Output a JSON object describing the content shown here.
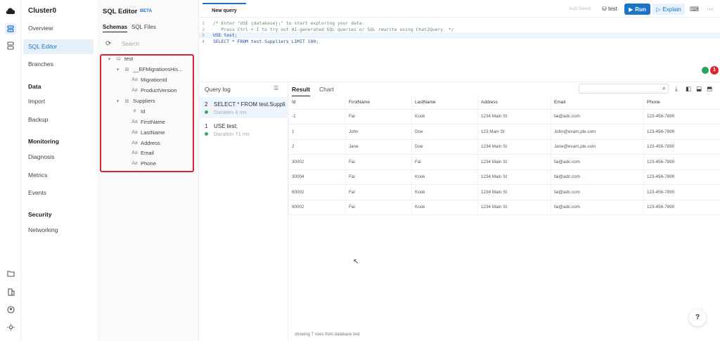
{
  "app": {
    "cluster_name": "Cluster0"
  },
  "nav": {
    "items": [
      {
        "label": "Overview"
      },
      {
        "label": "SQL Editor"
      },
      {
        "label": "Branches"
      }
    ],
    "data_section": "Data",
    "data_items": [
      {
        "label": "Import"
      },
      {
        "label": "Backup"
      }
    ],
    "monitoring_section": "Monitoring",
    "monitoring_items": [
      {
        "label": "Diagnosis"
      },
      {
        "label": "Metrics"
      },
      {
        "label": "Events"
      }
    ],
    "security_section": "Security",
    "security_items": [
      {
        "label": "Networking"
      }
    ]
  },
  "schema_panel": {
    "title": "SQL Editor",
    "badge": "BETA",
    "tabs": [
      "Schemas",
      "SQL Files"
    ],
    "search_placeholder": "Search",
    "tree": {
      "database": "test",
      "tables": [
        {
          "name": "__EFMigrationsHis...",
          "columns": [
            "MigrationId",
            "ProductVersion"
          ]
        },
        {
          "name": "Suppliers",
          "columns": [
            "Id",
            "FirstName",
            "LastName",
            "Address",
            "Email",
            "Phone"
          ]
        }
      ]
    }
  },
  "editor": {
    "tab": "New query",
    "autosave": "Auto Saved",
    "database": "test",
    "run_label": "Run",
    "explain_label": "Explain",
    "lines": [
      {
        "n": "1",
        "text": "/* Enter \"USE {database};\" to start exploring your data."
      },
      {
        "n": "2",
        "text": "   Press Ctrl + I to try out AI-generated SQL queries or SQL rewrite using Chat2Query. */"
      },
      {
        "n": "3",
        "text": "USE test;"
      },
      {
        "n": "4",
        "text": "SELECT * FROM test.Suppliers LIMIT 100;"
      }
    ],
    "notification_count": "1"
  },
  "query_log": {
    "title": "Query log",
    "entries": [
      {
        "num": "2",
        "sql": "SELECT * FROM test.Suppli...",
        "duration": "Duration 4 ms"
      },
      {
        "num": "1",
        "sql": "USE test;",
        "duration": "Duration 71 ms"
      }
    ]
  },
  "results": {
    "tabs": [
      "Result",
      "Chart"
    ],
    "columns": [
      "Id",
      "FirstName",
      "LastName",
      "Address",
      "Email",
      "Phone"
    ],
    "rows": [
      [
        "-1",
        "Fai",
        "Kook",
        "1234 Main St",
        "fai@adc.com",
        "123-456-7890"
      ],
      [
        "1",
        "John",
        "Doe",
        "123 Main St",
        "John@exam,ple.com",
        "123-456-7890"
      ],
      [
        "2",
        "Jane",
        "Doe",
        "1234 Main St",
        "Jane@exam,ple.com",
        "123-456-7890"
      ],
      [
        "30002",
        "Fai",
        "Fai",
        "1234 Main St",
        "fai@adc.com",
        "123-456-7890"
      ],
      [
        "30004",
        "Fai",
        "Kook",
        "1234 Main St",
        "fai@adc.com",
        "123-456-7890"
      ],
      [
        "60002",
        "Fai",
        "Kook",
        "1234 Main St",
        "fai@adc.com",
        "123-456-7890"
      ],
      [
        "90002",
        "Fai",
        "Kook",
        "1234 Main St",
        "fai@adc.com",
        "123-456-7890"
      ]
    ],
    "footer": "showing 7 rows from database test"
  },
  "help_label": "?"
}
